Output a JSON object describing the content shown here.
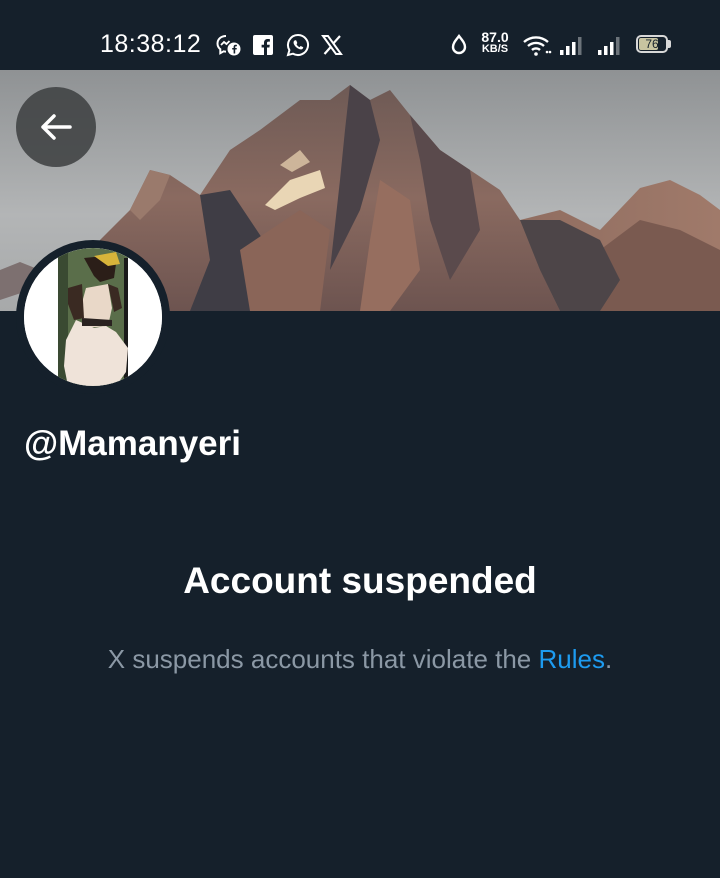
{
  "status_bar": {
    "time": "18:38:12",
    "notification_icons": [
      "messenger-icon",
      "facebook-icon",
      "whatsapp-icon",
      "x-icon"
    ],
    "net_speed_value": "87.0",
    "net_speed_unit": "KB/S",
    "battery_level": "76",
    "battery_fraction": 0.76
  },
  "header": {
    "back_icon": "arrow-left-icon"
  },
  "profile": {
    "handle": "@Mamanyeri"
  },
  "suspension": {
    "title": "Account suspended",
    "message_prefix": "X suspends accounts that violate the ",
    "rules_link": "Rules",
    "message_suffix": "."
  },
  "colors": {
    "background": "#15202b",
    "link": "#1d9bf0",
    "secondary_text": "#8b98a5"
  }
}
